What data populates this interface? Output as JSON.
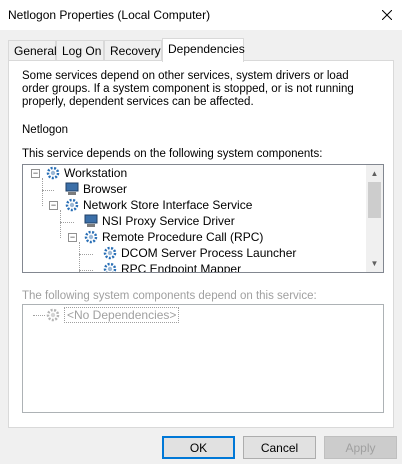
{
  "window": {
    "title": "Netlogon Properties (Local Computer)"
  },
  "tabs": [
    {
      "label": "General"
    },
    {
      "label": "Log On"
    },
    {
      "label": "Recovery"
    },
    {
      "label": "Dependencies"
    }
  ],
  "content": {
    "description": "Some services depend on other services, system drivers or load order groups. If a system component is stopped, or is not running properly, dependent services can be affected.",
    "service_name": "Netlogon",
    "depends_on_label": "This service depends on the following system components:",
    "depends_on_tree": [
      {
        "label": "Workstation",
        "toggle": "−"
      },
      {
        "label": "Browser"
      },
      {
        "label": "Network Store Interface Service",
        "toggle": "−"
      },
      {
        "label": "NSI Proxy Service Driver"
      },
      {
        "label": "Remote Procedure Call (RPC)",
        "toggle": "−"
      },
      {
        "label": "DCOM Server Process Launcher"
      },
      {
        "label": "RPC Endpoint Mapper"
      }
    ],
    "dependents_label": "The following system components depend on this service:",
    "dependents_tree": [
      {
        "label": "<No Dependencies>"
      }
    ]
  },
  "buttons": {
    "ok": "OK",
    "cancel": "Cancel",
    "apply": "Apply"
  },
  "icons": {
    "close": "close-icon",
    "service": "gear-icon",
    "computer": "computer-icon"
  }
}
